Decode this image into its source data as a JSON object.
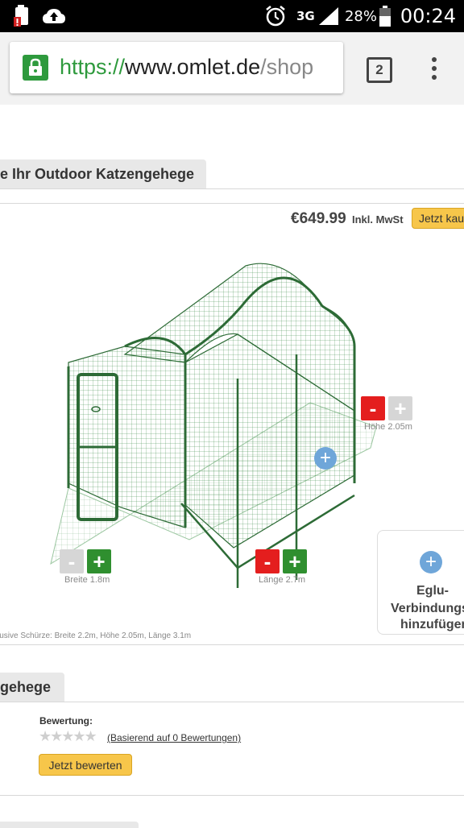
{
  "status_bar": {
    "network": "3G",
    "battery": "28%",
    "time": "00:24"
  },
  "browser": {
    "url_scheme": "https://",
    "url_host": "www.omlet.de",
    "url_path": "/shop",
    "tab_count": "2"
  },
  "page": {
    "section_title": "e Ihr Outdoor Katzengehege",
    "price": "€649.99",
    "price_note": "Inkl. MwSt",
    "buy_label": "Jetzt kau",
    "controls": {
      "height_label": "Höhe 2.05m",
      "width_label": "Breite 1.8m",
      "length_label": "Länge 2.7m",
      "minus": "-",
      "plus": "+"
    },
    "eglu": {
      "line1": "Eglu-",
      "line2": "Verbindungss",
      "line3": "hinzufügen"
    },
    "dimensions_text": "lusive Schürze: Breite 2.2m, Höhe 2.05m, Länge 3.1m",
    "section2_title": "gehege",
    "review": {
      "label": "Bewertung:",
      "stars": "★★★★★",
      "count_text": "(Basierend auf 0 Bewertungen)",
      "rate_button": "Jetzt bewerten"
    }
  },
  "colors": {
    "accent_green": "#2e9a3d",
    "button_yellow": "#f7c64a",
    "minus_red": "#e41e1e",
    "plus_green": "#2f8f2f",
    "info_blue": "#6fa6d9",
    "frame_green": "#2d6b36"
  }
}
